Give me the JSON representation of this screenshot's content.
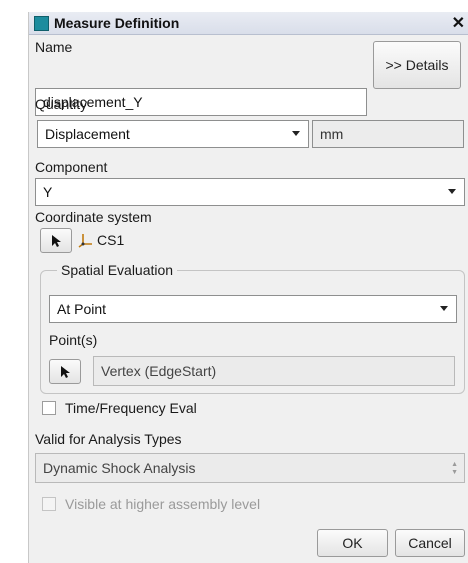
{
  "window": {
    "title": "Measure Definition",
    "close_glyph": "✕"
  },
  "name": {
    "label": "Name",
    "value": "displacement_Y",
    "details_button": ">> Details"
  },
  "quantity": {
    "label": "Quantity",
    "selected": "Displacement",
    "unit": "mm"
  },
  "component": {
    "label": "Component",
    "selected": "Y"
  },
  "coordinate_system": {
    "label": "Coordinate system",
    "value": "CS1"
  },
  "spatial_evaluation": {
    "title": "Spatial Evaluation",
    "selected": "At Point",
    "points_label": "Point(s)",
    "points_value": "Vertex (EdgeStart)"
  },
  "time_frequency": {
    "label": "Time/Frequency Eval",
    "checked": false
  },
  "analysis_types": {
    "label": "Valid for Analysis Types",
    "value": "Dynamic Shock Analysis"
  },
  "visible_higher": {
    "label": "Visible at higher assembly level",
    "checked": false,
    "disabled": true
  },
  "buttons": {
    "ok": "OK",
    "cancel": "Cancel"
  },
  "icons": {
    "title": "measure-icon",
    "pick": "cursor-arrow-icon",
    "csys": "coordinate-system-icon"
  },
  "colors": {
    "accent": "#1c8c9e",
    "text": "#1a1a1a",
    "panel": "#f0f0f0"
  }
}
